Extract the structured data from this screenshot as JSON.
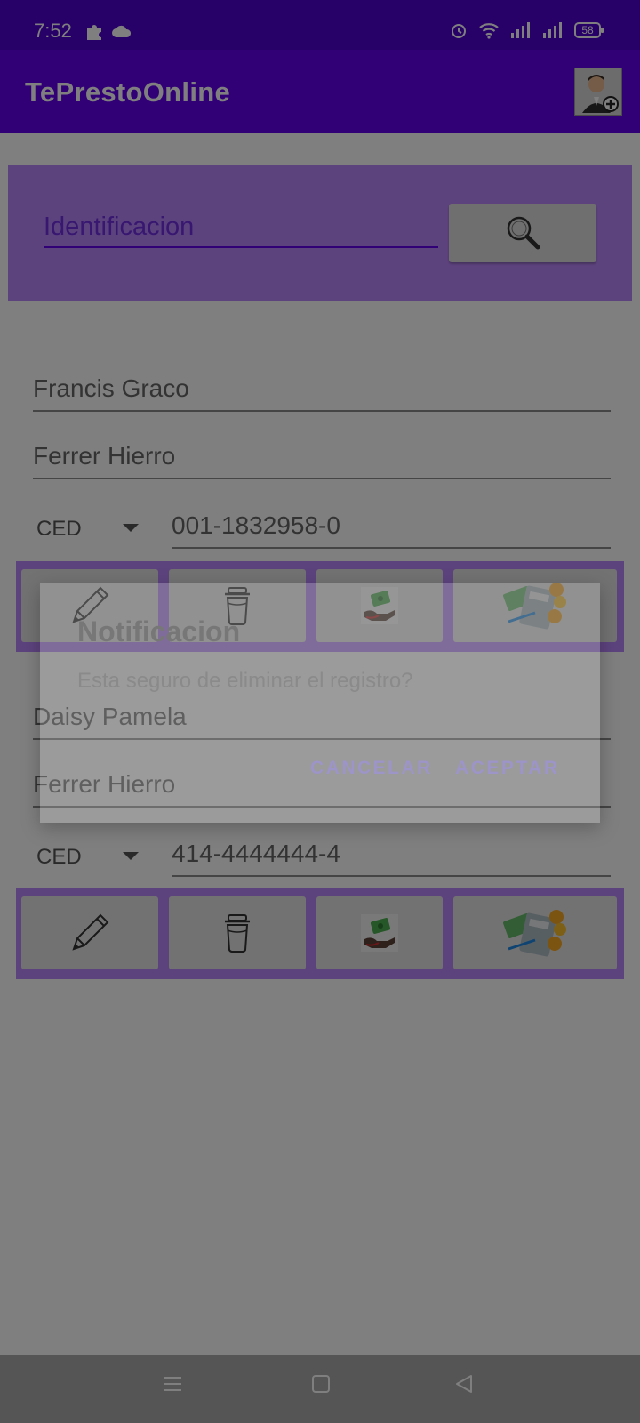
{
  "status": {
    "time": "7:52",
    "battery": "58"
  },
  "appbar": {
    "title": "TePrestoOnline"
  },
  "search": {
    "placeholder": "Identificacion"
  },
  "records": [
    {
      "first_names": "Francis Graco",
      "last_names": "Ferrer Hierro",
      "id_type": "CED",
      "id_number": "001-1832958-0"
    },
    {
      "first_names": "Daisy Pamela",
      "last_names": "Ferrer Hierro",
      "id_type": "CED",
      "id_number": "414-4444444-4"
    }
  ],
  "dialog": {
    "title": "Notificacion",
    "message": "Esta seguro de eliminar el registro?",
    "cancel_label": "CANCELAR",
    "accept_label": "ACEPTAR"
  },
  "icons": {
    "edit": "pencil-icon",
    "delete": "trash-icon",
    "payment": "money-hand-icon",
    "loan": "calculator-money-icon"
  },
  "colors": {
    "primary": "#6200ee",
    "status_bar": "#4e00d1",
    "accent_light": "#bb86fc"
  }
}
